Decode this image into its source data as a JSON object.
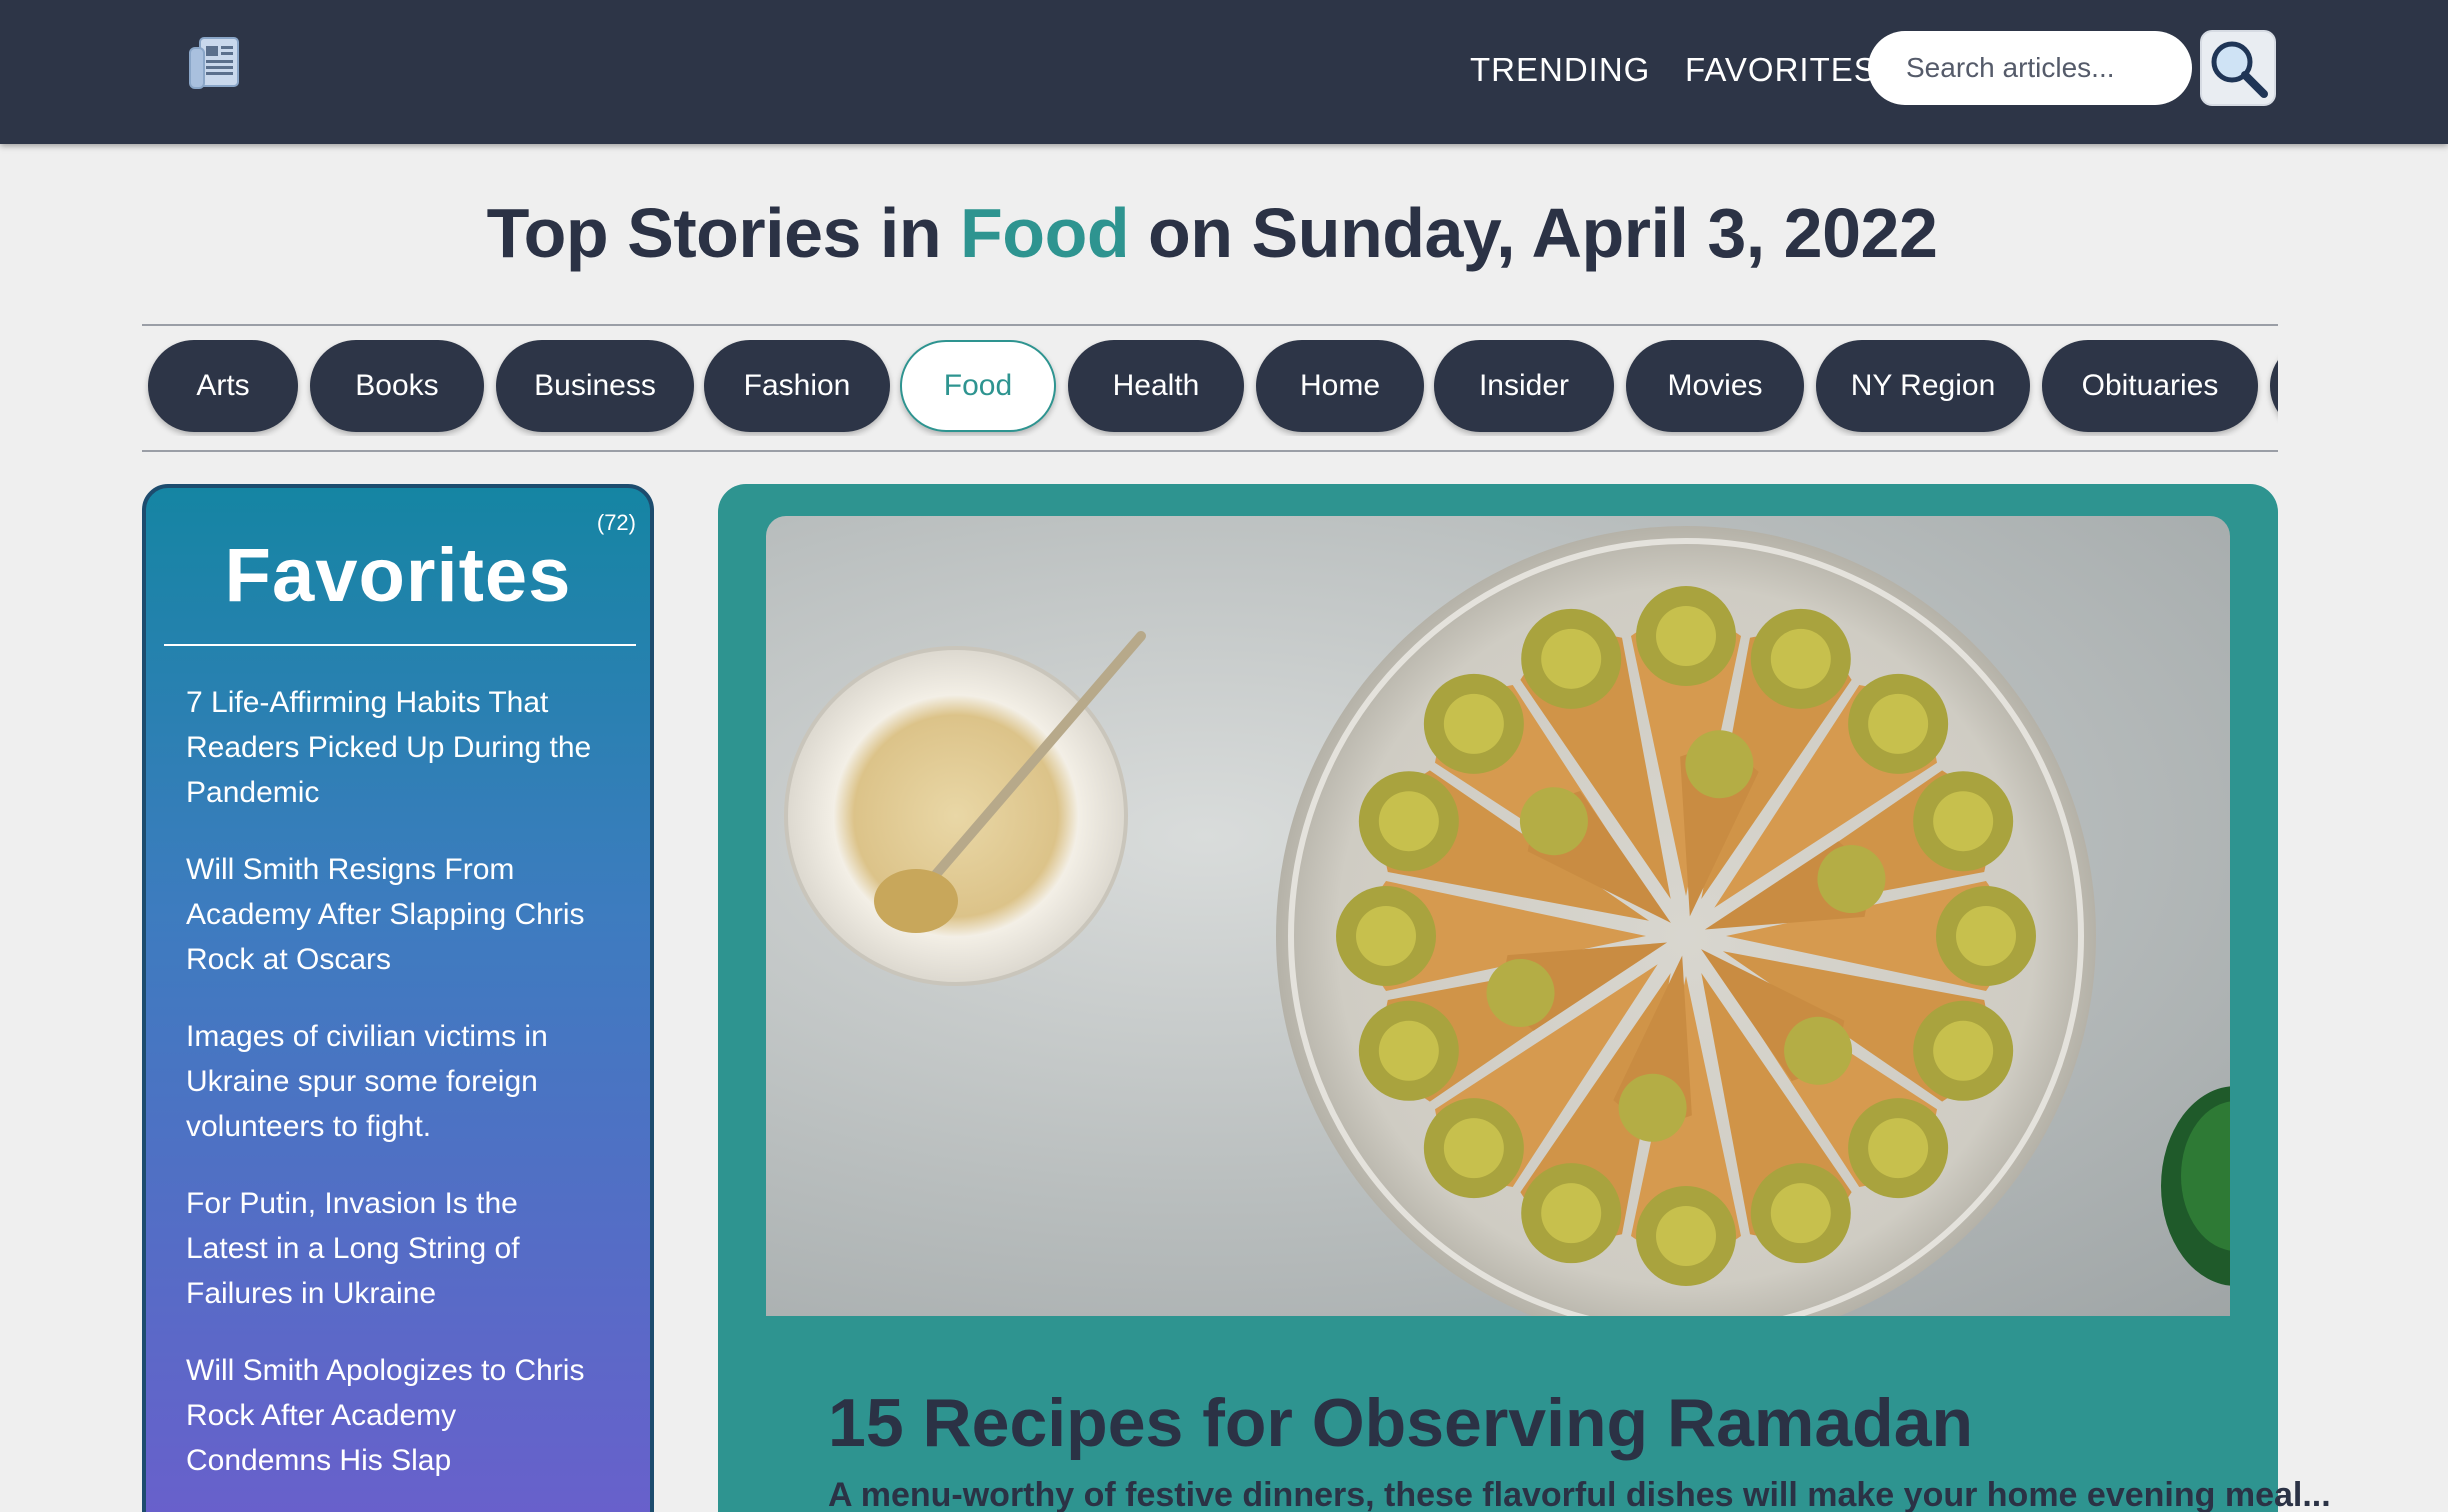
{
  "header": {
    "logo_icon": "newspaper-icon",
    "nav": [
      {
        "label": "TRENDING"
      },
      {
        "label": "FAVORITES"
      }
    ],
    "search": {
      "placeholder": "Search articles...",
      "value": ""
    },
    "search_icon": "magnifier-icon"
  },
  "title": {
    "prefix": "Top Stories in ",
    "section": "Food",
    "suffix": " on Sunday, April 3, 2022"
  },
  "categories": [
    {
      "label": "Arts",
      "active": false
    },
    {
      "label": "Books",
      "active": false
    },
    {
      "label": "Business",
      "active": false
    },
    {
      "label": "Fashion",
      "active": false
    },
    {
      "label": "Food",
      "active": true
    },
    {
      "label": "Health",
      "active": false
    },
    {
      "label": "Home",
      "active": false
    },
    {
      "label": "Insider",
      "active": false
    },
    {
      "label": "Movies",
      "active": false
    },
    {
      "label": "NY Region",
      "active": false
    },
    {
      "label": "Obituaries",
      "active": false
    }
  ],
  "favorites": {
    "title": "Favorites",
    "count": "(72)",
    "items": [
      "7 Life-Affirming Habits That Readers Picked Up During the Pandemic",
      "Will Smith Resigns From Academy After Slapping Chris Rock at Oscars",
      "Images of civilian victims in Ukraine spur some foreign volunteers to fight.",
      "For Putin, Invasion Is the Latest in a Long String of Failures in Ukraine",
      "Will Smith Apologizes to Chris Rock After Academy Condemns His Slap"
    ]
  },
  "feature": {
    "title": "15 Recipes for Observing Ramadan",
    "subtitle": "A menu-worthy of festive dinners, these flavorful dishes will make your home evening meal..."
  },
  "colors": {
    "header_bg": "#2d3547",
    "accent": "#2e9490",
    "pill_bg": "#2d3547",
    "page_bg": "#efefef"
  }
}
